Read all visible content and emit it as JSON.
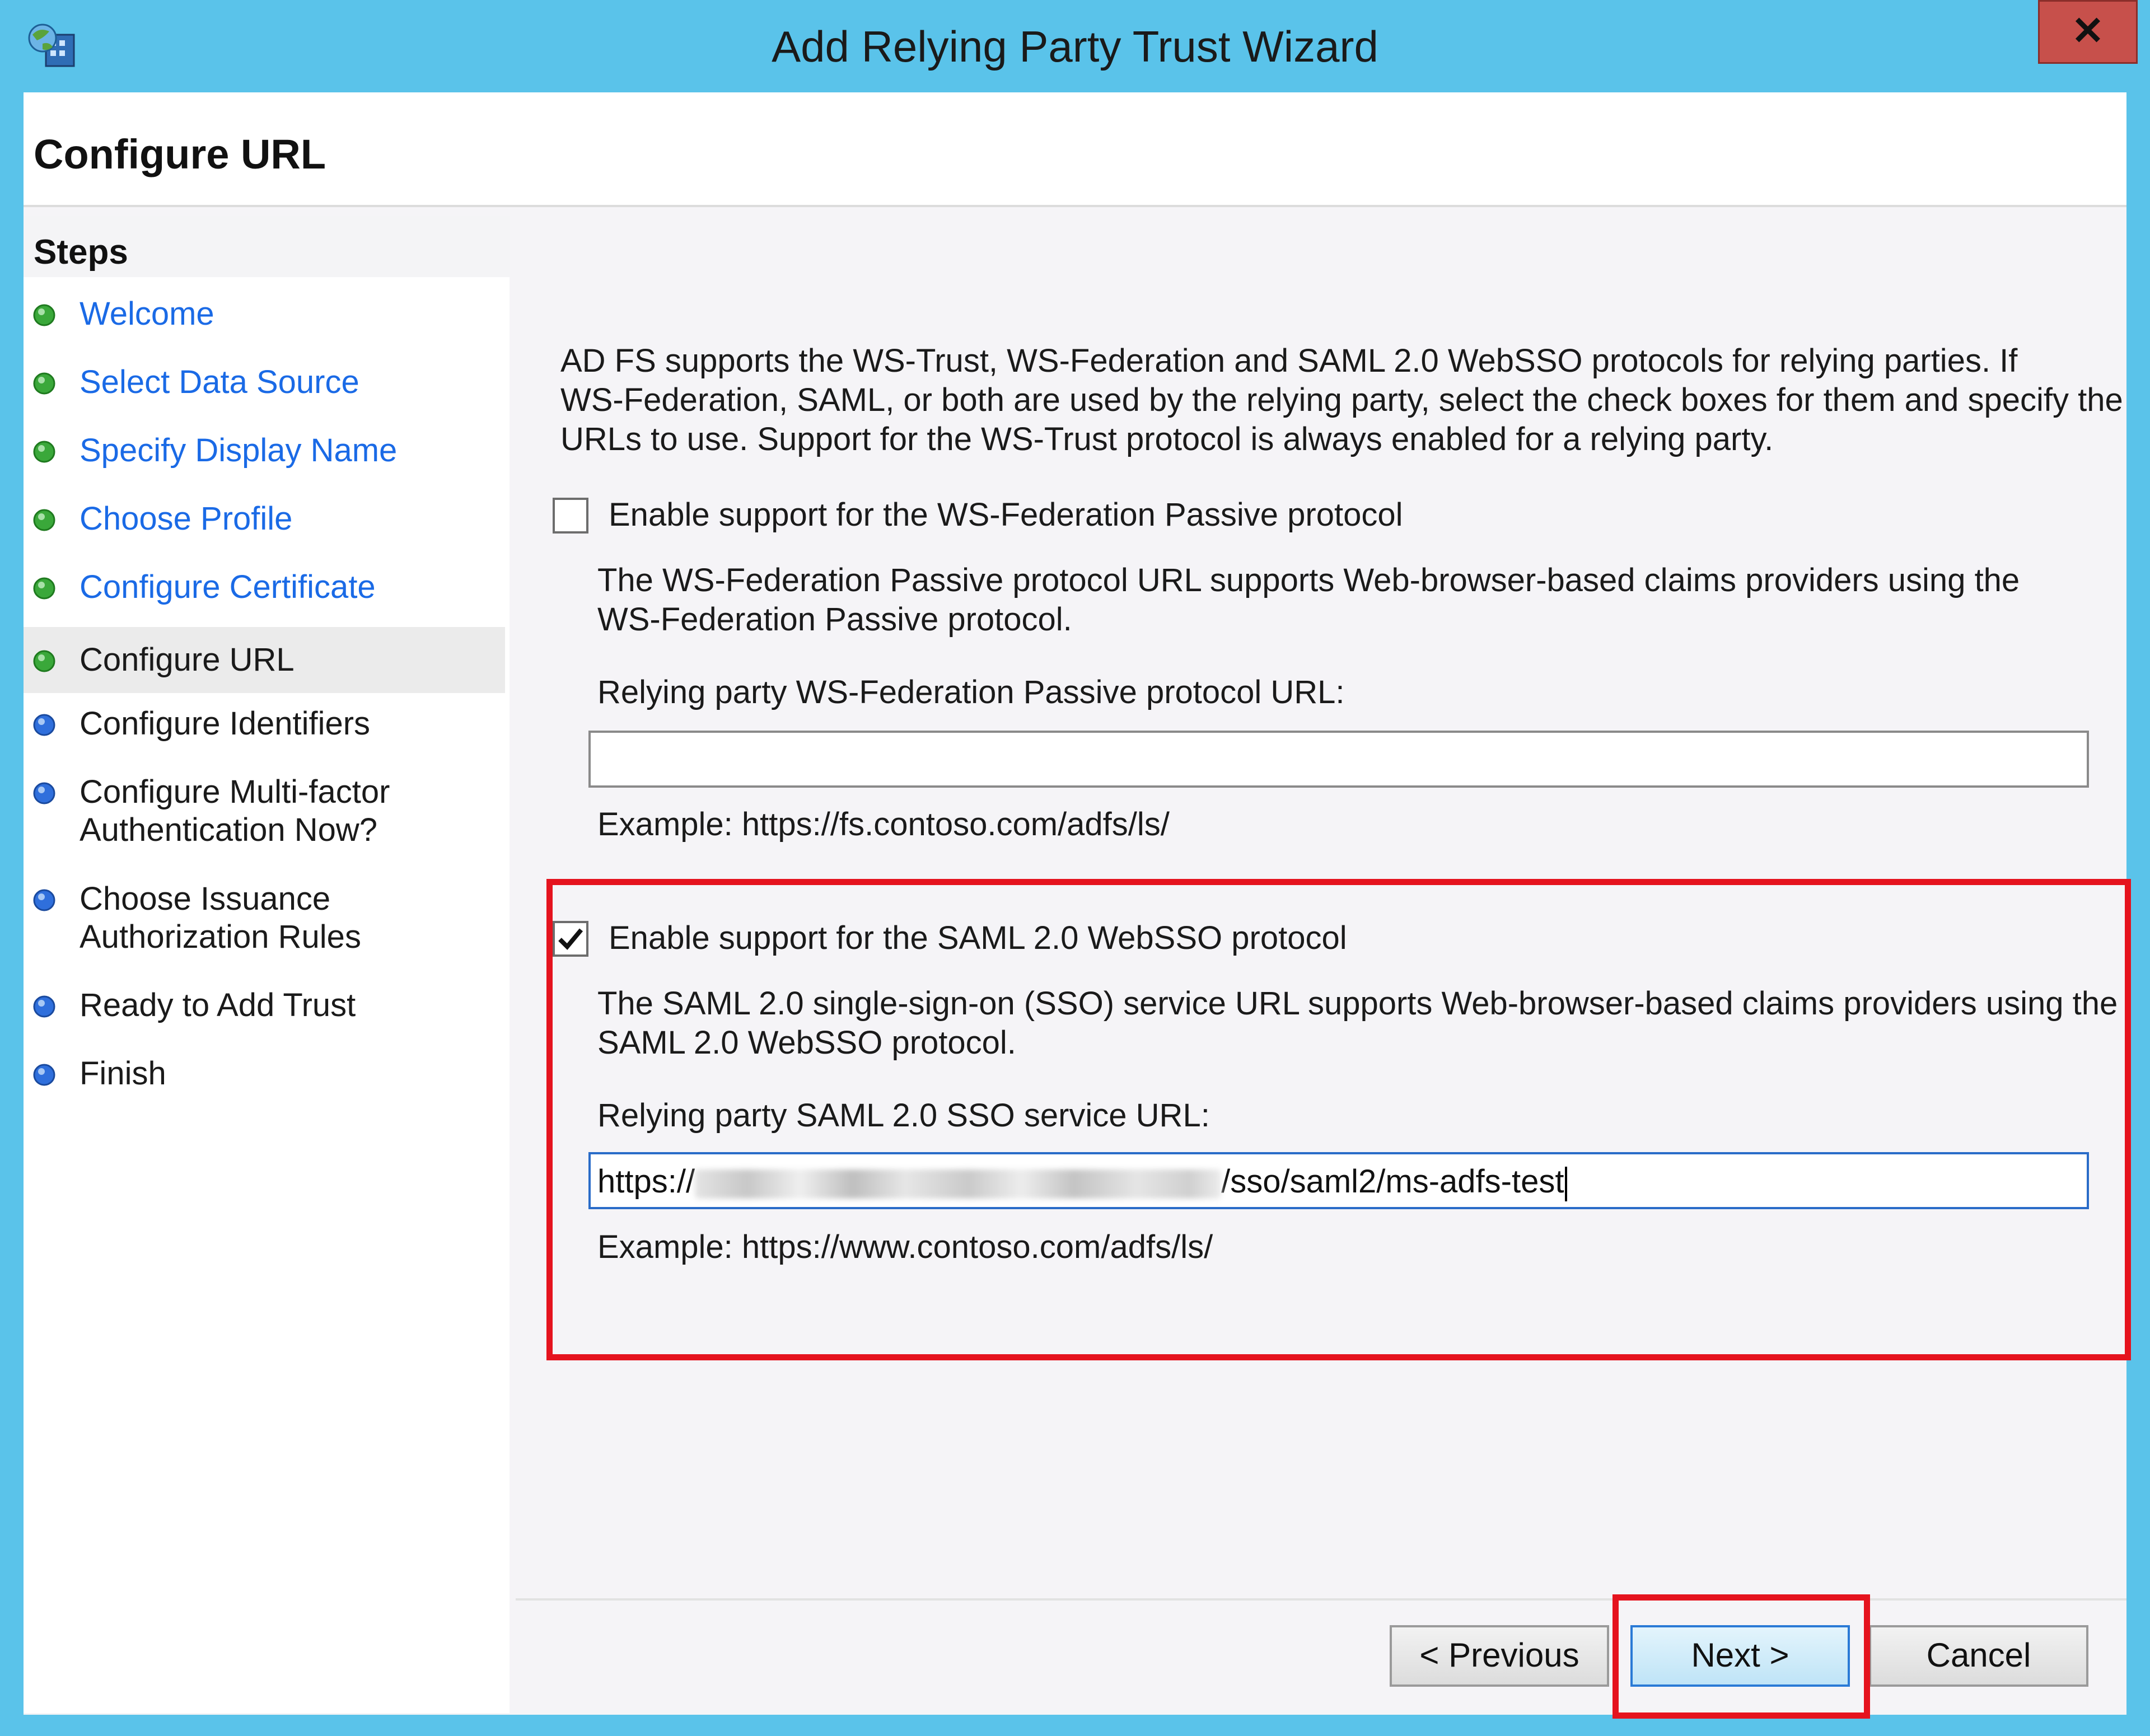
{
  "window": {
    "title": "Add Relying Party Trust Wizard",
    "close_label": "✕",
    "app_icon": "adfs-snapin-icon"
  },
  "header": {
    "title": "Configure URL"
  },
  "steps": {
    "title": "Steps",
    "items": [
      {
        "label": "Welcome",
        "state": "done"
      },
      {
        "label": "Select Data Source",
        "state": "done"
      },
      {
        "label": "Specify Display Name",
        "state": "done"
      },
      {
        "label": "Choose Profile",
        "state": "done"
      },
      {
        "label": "Configure Certificate",
        "state": "done"
      },
      {
        "label": "Configure URL",
        "state": "current"
      },
      {
        "label": "Configure Identifiers",
        "state": "pending"
      },
      {
        "label": "Configure Multi-factor",
        "label2": "Authentication Now?",
        "state": "pending"
      },
      {
        "label": "Choose Issuance",
        "label2": "Authorization Rules",
        "state": "pending"
      },
      {
        "label": "Ready to Add Trust",
        "state": "pending"
      },
      {
        "label": "Finish",
        "state": "pending"
      }
    ],
    "colors": {
      "done": "#3aa83a",
      "pending": "#2f6fdc"
    }
  },
  "intro": {
    "line1": "AD FS supports the WS-Trust, WS-Federation and SAML 2.0 WebSSO protocols for relying parties.  If",
    "line2": "WS-Federation, SAML, or both are used by the relying party, select the check boxes for them and specify the",
    "line3": "URLs to use.  Support for the WS-Trust protocol is always enabled for a relying party."
  },
  "wsfed": {
    "checked": false,
    "checkbox_label": "Enable support for the WS-Federation Passive protocol",
    "desc1": "The WS-Federation Passive protocol URL supports Web-browser-based claims providers using the",
    "desc2": "WS-Federation Passive protocol.",
    "url_label": "Relying party WS-Federation Passive protocol URL:",
    "url_value": "",
    "example": "Example: https://fs.contoso.com/adfs/ls/"
  },
  "saml": {
    "checked": true,
    "checkbox_label": "Enable support for the SAML 2.0 WebSSO protocol",
    "desc1": "The SAML 2.0 single-sign-on (SSO) service URL supports Web-browser-based claims providers using the",
    "desc2": "SAML 2.0 WebSSO protocol.",
    "url_label": "Relying party SAML 2.0 SSO service URL:",
    "url_prefix": "https://",
    "url_suffix": "/sso/saml2/ms-adfs-test",
    "example": "Example: https://www.contoso.com/adfs/ls/"
  },
  "buttons": {
    "previous": "< Previous",
    "next": "Next >",
    "cancel": "Cancel"
  },
  "accent": {
    "highlight": "#e5131e",
    "link": "#1a6ae6"
  }
}
